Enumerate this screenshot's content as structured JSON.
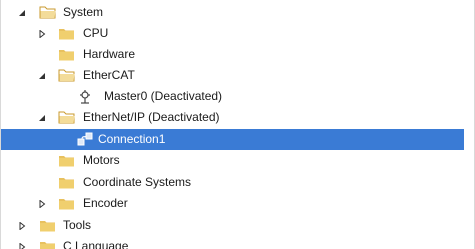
{
  "tree": {
    "items": [
      {
        "label": "System",
        "icon": "folder-open-icon",
        "expander": "expanded"
      },
      {
        "label": "CPU",
        "icon": "folder-icon",
        "expander": "collapsed"
      },
      {
        "label": "Hardware",
        "icon": "folder-icon",
        "expander": "none"
      },
      {
        "label": "EtherCAT",
        "icon": "folder-open-icon",
        "expander": "expanded"
      },
      {
        "label": "Master0 (Deactivated)",
        "icon": "master-node-icon",
        "expander": "none"
      },
      {
        "label": "EtherNet/IP (Deactivated)",
        "icon": "folder-open-icon",
        "expander": "expanded"
      },
      {
        "label": "Connection1",
        "icon": "connection-icon",
        "expander": "none",
        "selected": true
      },
      {
        "label": "Motors",
        "icon": "folder-icon",
        "expander": "none"
      },
      {
        "label": "Coordinate Systems",
        "icon": "folder-icon",
        "expander": "none"
      },
      {
        "label": "Encoder",
        "icon": "folder-icon",
        "expander": "collapsed"
      },
      {
        "label": "Tools",
        "icon": "folder-icon",
        "expander": "collapsed"
      },
      {
        "label": "C Language",
        "icon": "folder-icon",
        "expander": "collapsed"
      }
    ]
  },
  "colors": {
    "selection": "#3a7bd5",
    "folder": "#e8c15f",
    "folder_dark": "#c99a2e"
  }
}
